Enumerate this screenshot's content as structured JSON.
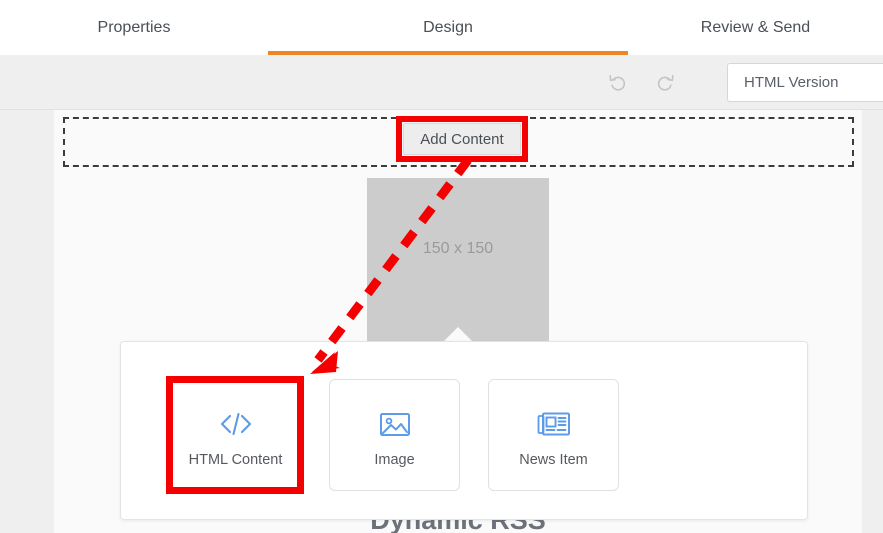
{
  "tabs": [
    {
      "label": "Properties",
      "active": false
    },
    {
      "label": "Design",
      "active": true
    },
    {
      "label": "Review & Send",
      "active": false
    }
  ],
  "toolbar": {
    "undo_icon": "undo-icon",
    "redo_icon": "redo-icon",
    "html_version_label": "HTML Version"
  },
  "canvas": {
    "add_content_label": "Add Content",
    "image_placeholder_label": "150 x 150",
    "dynamic_rss_heading": "Dynamic RSS"
  },
  "content_picker": {
    "cards": [
      {
        "label": "HTML Content",
        "icon": "code-brackets-icon"
      },
      {
        "label": "Image",
        "icon": "picture-icon"
      },
      {
        "label": "News Item",
        "icon": "newspaper-icon"
      }
    ]
  },
  "annotations": {
    "highlight_add_content": "Add Content",
    "highlight_html_content": "HTML Content",
    "arrow": "dashed-arrow-add-content-to-html-content"
  },
  "colors": {
    "accent_orange": "#ee8422",
    "annotation_red": "#f40000",
    "icon_blue": "#5b9be8",
    "toolbar_grey": "#efefef",
    "canvas_grey": "#fafafa"
  }
}
